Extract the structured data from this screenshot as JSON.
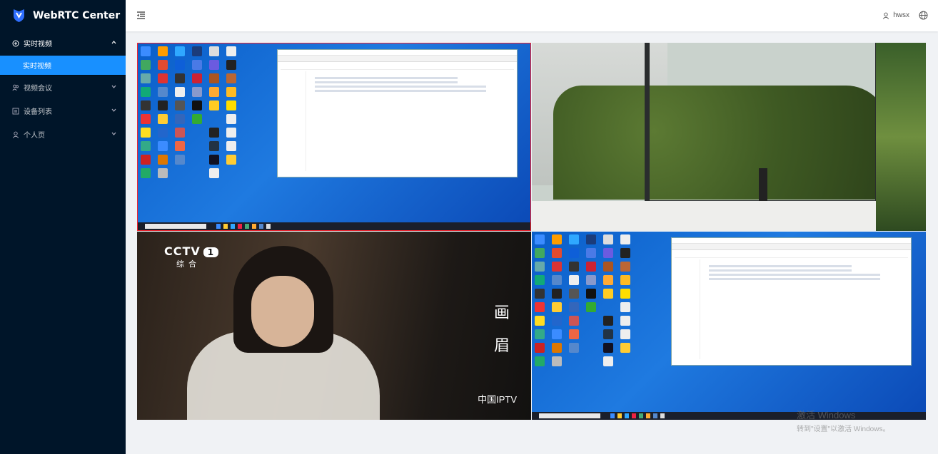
{
  "app": {
    "title": "WebRTC Center"
  },
  "sidebar": {
    "items": [
      {
        "label": "实时视频",
        "icon": "video-icon",
        "open": true,
        "children": [
          {
            "label": "实时视频",
            "active": true
          }
        ]
      },
      {
        "label": "视频会议",
        "icon": "team-icon",
        "open": false
      },
      {
        "label": "设备列表",
        "icon": "list-icon",
        "open": false
      },
      {
        "label": "个人页",
        "icon": "user-icon",
        "open": false
      }
    ]
  },
  "header": {
    "username": "hwsx"
  },
  "videos": [
    {
      "kind": "remote-desktop",
      "selected": true
    },
    {
      "kind": "camera-window-view"
    },
    {
      "kind": "tv-broadcast",
      "channel_logo": "CCTV",
      "channel_number": "1",
      "channel_sub": "综合",
      "overlay_text": "画眉",
      "corner_text": "中国IPTV"
    },
    {
      "kind": "remote-desktop"
    }
  ],
  "watermark": {
    "line1": "激活 Windows",
    "line2": "转到\"设置\"以激活 Windows。"
  },
  "colors": {
    "sidebar_bg": "#001529",
    "accent": "#1890ff",
    "selected_border": "#f5222d"
  }
}
